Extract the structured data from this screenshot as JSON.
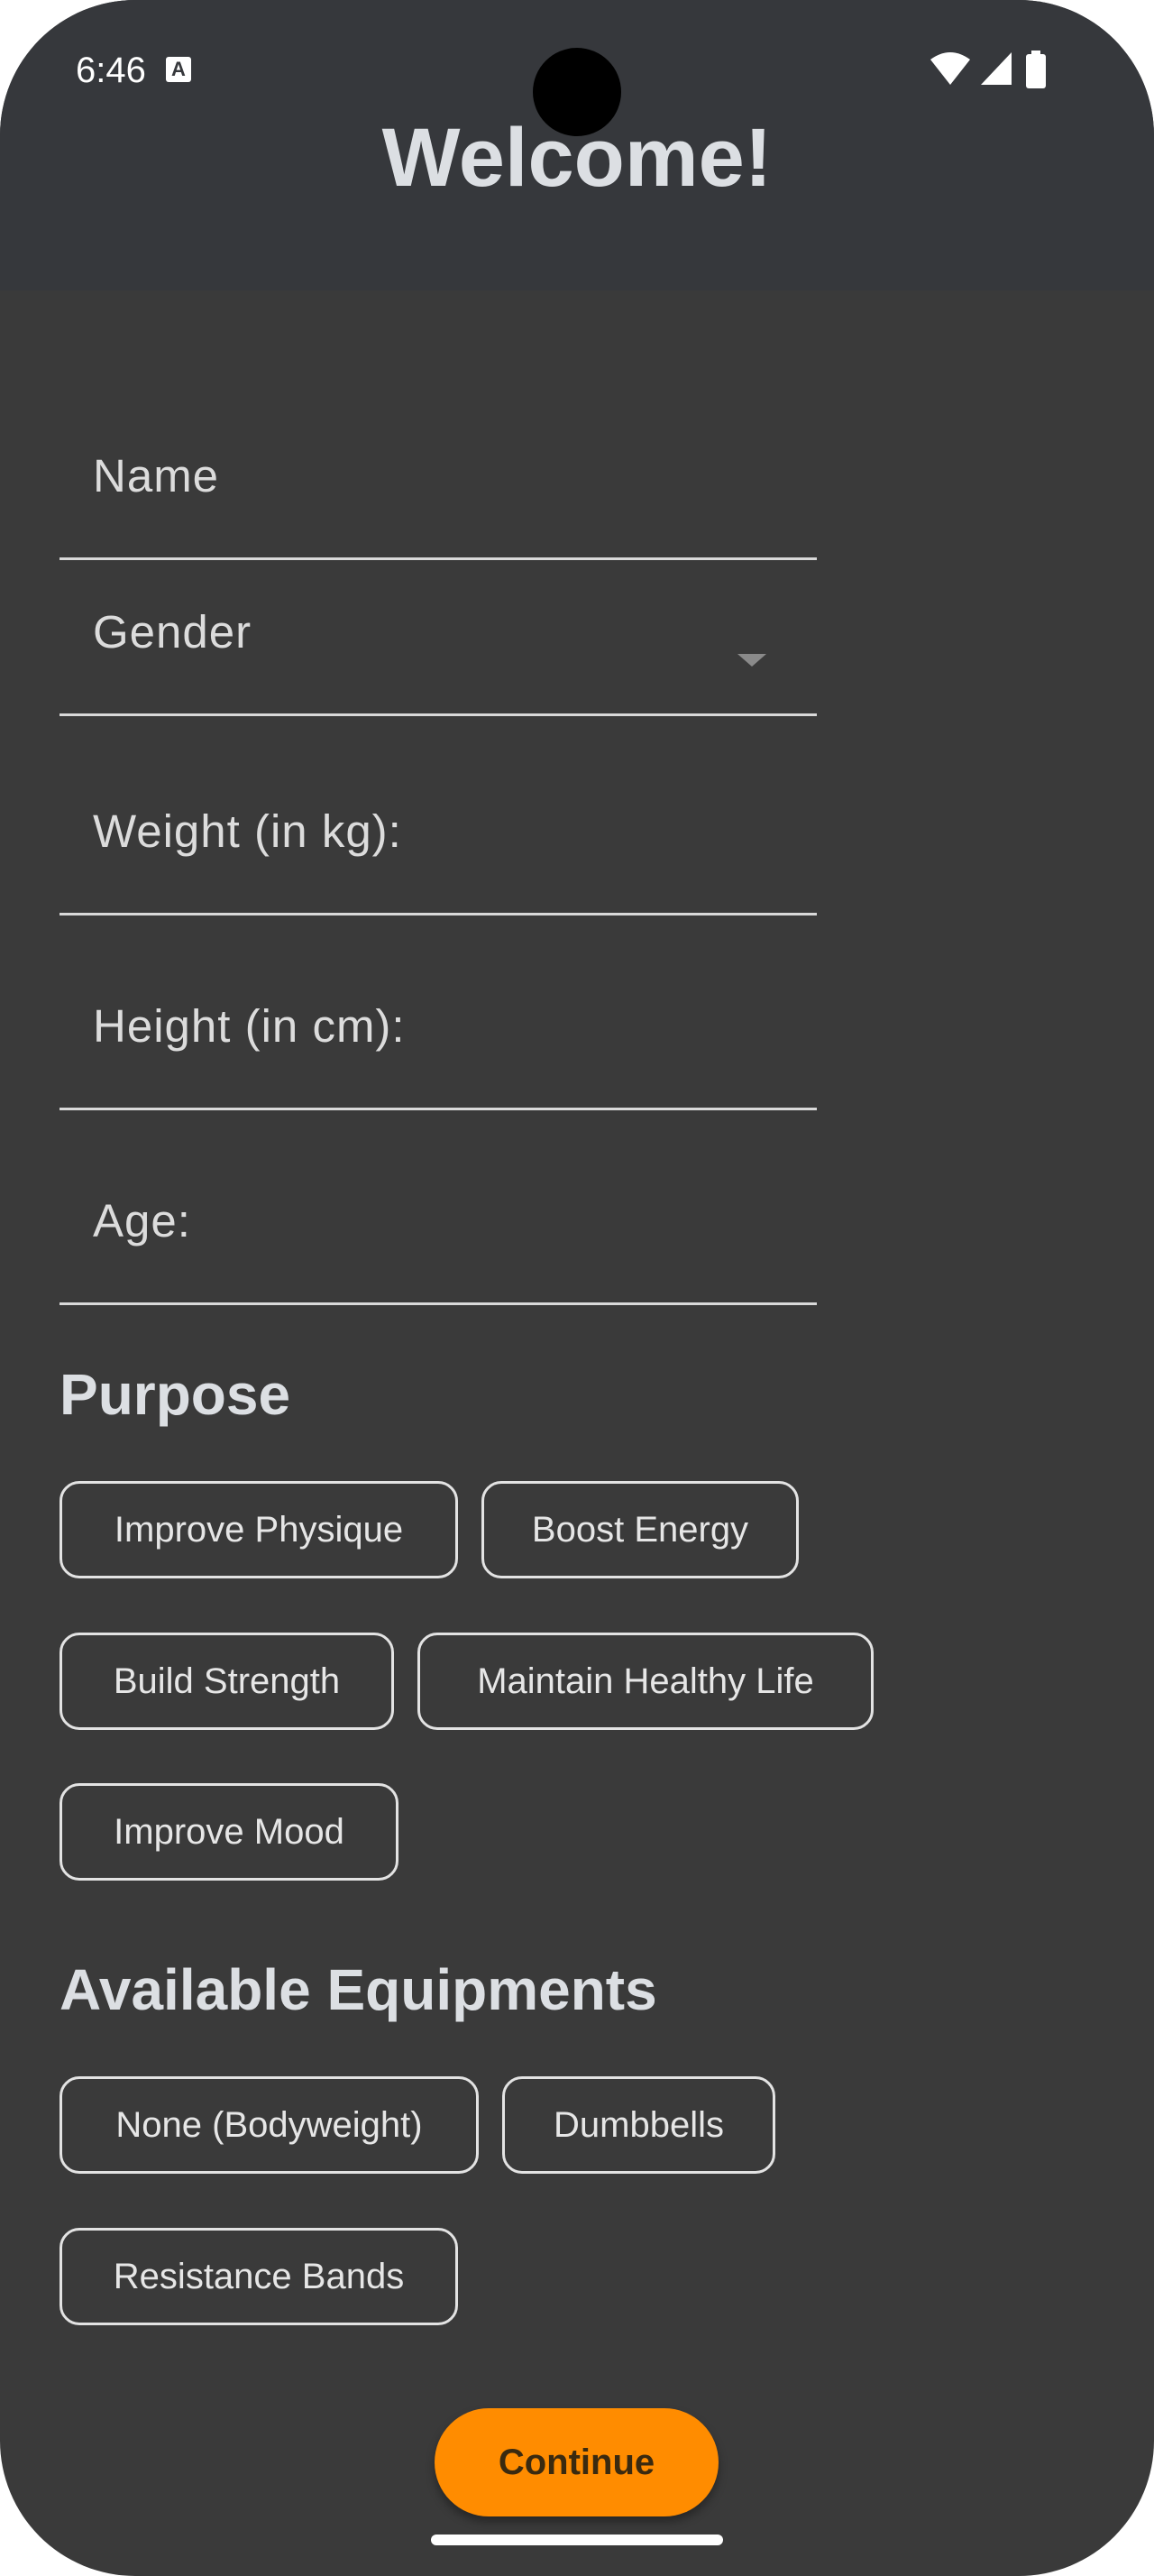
{
  "status_bar": {
    "time": "6:46",
    "notification_icon_letter": "A",
    "icons": [
      "wifi-icon",
      "signal-icon",
      "battery-icon"
    ]
  },
  "header": {
    "title": "Welcome!"
  },
  "form": {
    "name_label": "Name",
    "gender_label": "Gender",
    "weight_label": "Weight (in kg):",
    "height_label": "Height (in cm):",
    "age_label": "Age:"
  },
  "purpose": {
    "title": "Purpose",
    "options": [
      "Improve Physique",
      "Boost Energy",
      "Build Strength",
      "Maintain Healthy Life",
      "Improve Mood"
    ]
  },
  "equipment": {
    "title": "Available Equipments",
    "options": [
      "None (Bodyweight)",
      "Dumbbells",
      "Resistance Bands"
    ]
  },
  "actions": {
    "continue_label": "Continue"
  },
  "colors": {
    "background": "#3a3a3a",
    "header": "#36383c",
    "accent": "#ff8c00",
    "text": "#dcdfe3"
  }
}
